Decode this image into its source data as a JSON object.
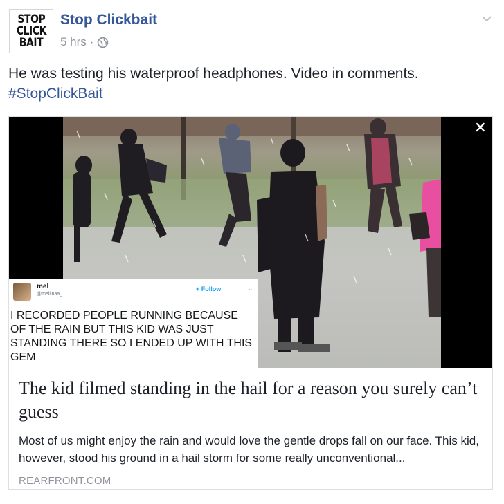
{
  "page": {
    "logo_lines": [
      "STOP",
      "CLICK",
      "BAIT"
    ],
    "name": "Stop Clickbait",
    "time": "5 hrs",
    "separator": "·",
    "privacy_icon": "globe-icon",
    "options_icon": "chevron-down-icon"
  },
  "post": {
    "message": "He was testing his waterproof headphones. Video in comments.",
    "hashtag": "#StopClickBait"
  },
  "card": {
    "close_glyph": "✕",
    "tweet": {
      "name": "mel",
      "handle": "@mellinaa_",
      "follow_label": "Follow",
      "chevron": "⌄",
      "text": "I RECORDED PEOPLE RUNNING BECAUSE OF THE RAIN BUT THIS KID WAS JUST STANDING THERE SO I ENDED UP WITH THIS GEM"
    },
    "headline": "The kid filmed standing in the hail for a reason you surely can’t guess",
    "description": "Most of us might enjoy the rain and would love the gentle drops fall on our face. This kid, however, stood his ground in a hail storm for some really unconventional...",
    "domain": "REARFRONT.COM"
  },
  "colors": {
    "link": "#365899",
    "meta": "#90949c",
    "text": "#1d2129",
    "border": "#dddfe2"
  }
}
